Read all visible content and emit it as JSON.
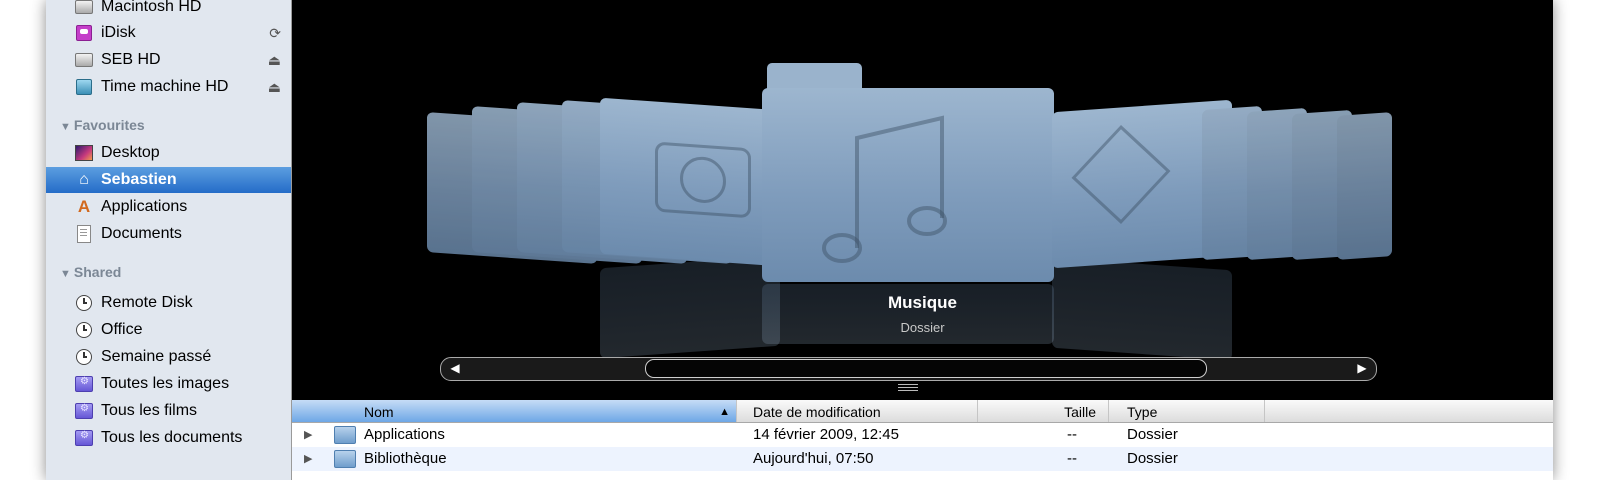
{
  "sidebar": {
    "devices": [
      {
        "label": "Macintosh HD",
        "icon": "hard-disk-icon",
        "action": ""
      },
      {
        "label": "iDisk",
        "icon": "idisk-icon",
        "action": "sync-icon"
      },
      {
        "label": "SEB HD",
        "icon": "hard-disk-icon",
        "action": "eject-icon"
      },
      {
        "label": "Time machine HD",
        "icon": "time-machine-disk-icon",
        "action": "eject-icon"
      }
    ],
    "favourites_header": "Favourites",
    "favourites": [
      {
        "label": "Desktop",
        "icon": "desktop-icon"
      },
      {
        "label": "Sebastien",
        "icon": "home-icon",
        "selected": true
      },
      {
        "label": "Applications",
        "icon": "applications-icon"
      },
      {
        "label": "Documents",
        "icon": "documents-icon"
      }
    ],
    "shared_header": "Shared",
    "shared": [
      {
        "label": "Remote Disk",
        "icon": "clock-icon"
      },
      {
        "label": "Office",
        "icon": "clock-icon"
      },
      {
        "label": "Semaine passé",
        "icon": "clock-icon"
      },
      {
        "label": "Toutes les images",
        "icon": "smart-folder-icon"
      },
      {
        "label": "Tous les films",
        "icon": "smart-folder-icon"
      },
      {
        "label": "Tous les documents",
        "icon": "smart-folder-icon"
      }
    ]
  },
  "coverflow": {
    "title": "Musique",
    "subtitle": "Dossier",
    "left_arrow": "◀",
    "right_arrow": "▶"
  },
  "list": {
    "columns": [
      "Nom",
      "Date de modification",
      "Taille",
      "Type"
    ],
    "sorted_column_indicator": "▲",
    "rows": [
      {
        "name": "Applications",
        "date": "14 février 2009, 12:45",
        "size": "--",
        "type": "Dossier"
      },
      {
        "name": "Bibliothèque",
        "date": "Aujourd'hui, 07:50",
        "size": "--",
        "type": "Dossier"
      }
    ]
  },
  "colors": {
    "selection": "#246cc8",
    "sidebar_bg": "#e1e7ef",
    "folder_blue": "#7f9cbc"
  }
}
